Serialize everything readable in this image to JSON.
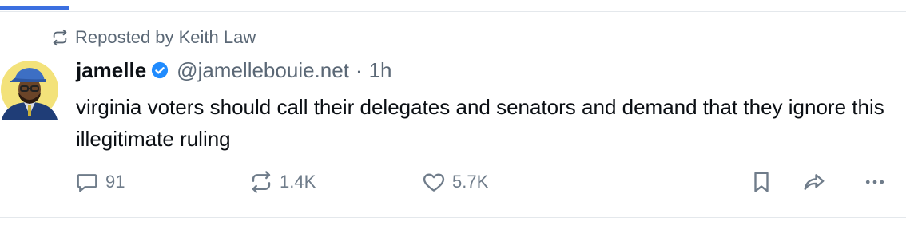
{
  "repost": {
    "label": "Reposted by Keith Law",
    "icon": "repost-icon"
  },
  "post": {
    "author_name": "jamelle",
    "verified_icon": "verified-badge-icon",
    "handle": "@jamellebouie.net",
    "separator": "·",
    "time": "1h",
    "text": "virginia voters should call their delegates and senators and demand that they ignore this illegitimate ruling"
  },
  "actions": {
    "reply_count": "91",
    "repost_count": "1.4K",
    "like_count": "5.7K",
    "icons": [
      "reply-icon",
      "repost-icon",
      "heart-icon",
      "bookmark-icon",
      "share-icon",
      "more-icon"
    ]
  },
  "colors": {
    "accent": "#3b6fe0",
    "verified": "#208bfe",
    "muted_text": "#5b6876",
    "action_gray": "#6f7c8a",
    "divider": "#e4e8ec"
  }
}
